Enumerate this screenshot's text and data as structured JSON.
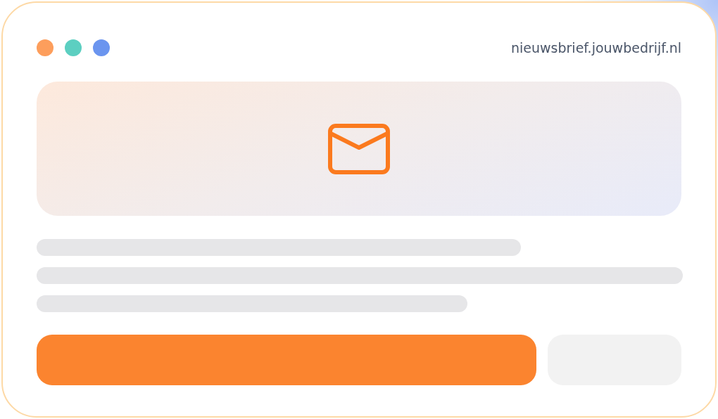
{
  "window": {
    "dots": [
      {
        "color": "#fd9e5c"
      },
      {
        "color": "#5ccfc1"
      },
      {
        "color": "#6b95ef"
      }
    ],
    "address": "nieuwsbrief.jouwbedrijf.nl"
  }
}
